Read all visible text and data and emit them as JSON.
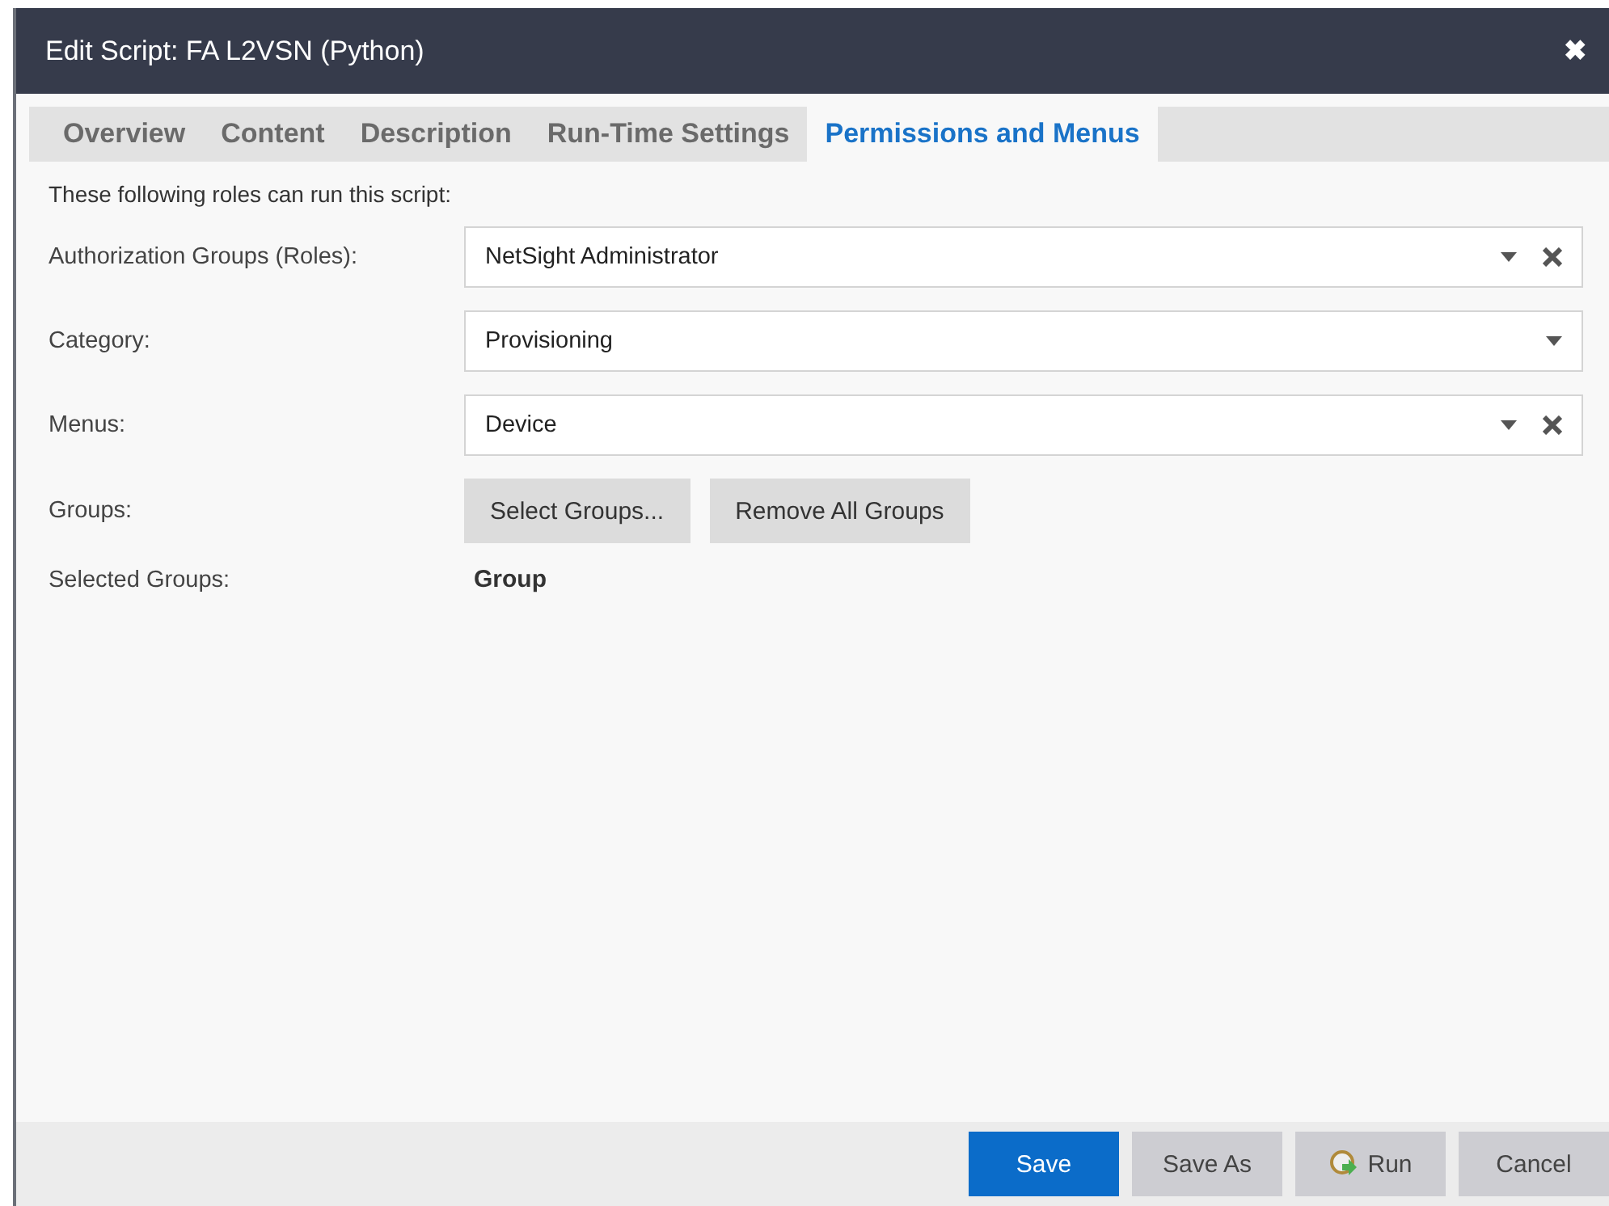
{
  "window": {
    "title": "Edit Script: FA L2VSN (Python)",
    "close": "✖"
  },
  "tabs": [
    {
      "label": "Overview",
      "selected": false
    },
    {
      "label": "Content",
      "selected": false
    },
    {
      "label": "Description",
      "selected": false
    },
    {
      "label": "Run-Time Settings",
      "selected": false
    },
    {
      "label": "Permissions and Menus",
      "selected": true
    }
  ],
  "intro": "These following roles can run this script:",
  "fields": [
    {
      "label": "Authorization Groups (Roles):",
      "value": "NetSight Administrator",
      "clearable": true
    },
    {
      "label": "Category:",
      "value": "Provisioning",
      "clearable": false
    },
    {
      "label": "Menus:",
      "value": "Device",
      "clearable": true
    }
  ],
  "groups": {
    "label": "Groups:",
    "buttons": [
      "Select Groups...",
      "Remove All Groups"
    ]
  },
  "selected_groups": {
    "label": "Selected Groups:",
    "column": "Group"
  },
  "footer_buttons": [
    {
      "label": "Save",
      "kind": "primary"
    },
    {
      "label": "Save As",
      "kind": "plain"
    },
    {
      "label": "Run",
      "kind": "run"
    },
    {
      "label": "Cancel",
      "kind": "plain"
    }
  ]
}
